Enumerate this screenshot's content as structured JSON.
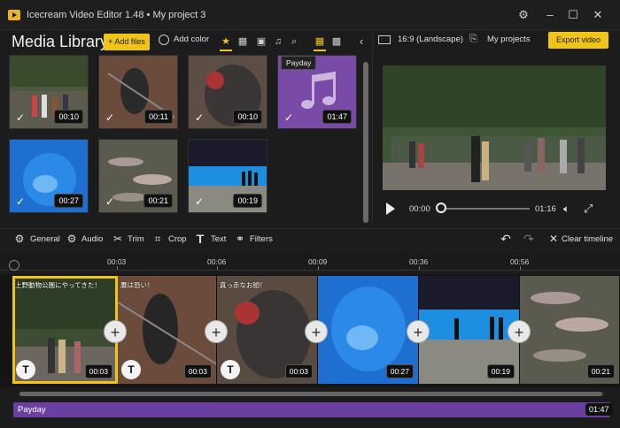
{
  "window": {
    "title": "Icecream Video Editor 1.48 • My project 3"
  },
  "library": {
    "title": "Media Library",
    "add_files": "+ Add files",
    "add_color": "Add color",
    "tooltip": "Payday",
    "items": [
      {
        "duration": "00:10",
        "kind": "video-zoo-people"
      },
      {
        "duration": "00:11",
        "kind": "video-bird-cage"
      },
      {
        "duration": "00:10",
        "kind": "video-bird-closeup"
      },
      {
        "duration": "01:47",
        "kind": "audio-payday"
      },
      {
        "duration": "00:27",
        "kind": "video-aquarium-blue"
      },
      {
        "duration": "00:21",
        "kind": "video-fish-school"
      },
      {
        "duration": "00:19",
        "kind": "video-aquarium-silhouette"
      }
    ]
  },
  "topright": {
    "aspect": "16:9 (Landscape)",
    "my_projects": "My projects",
    "export": "Export video"
  },
  "player": {
    "current": "00:00",
    "total": "01:16"
  },
  "edit_tools": {
    "general": "General",
    "audio": "Audio",
    "trim": "Trim",
    "crop": "Crop",
    "text": "Text",
    "filters": "Filters",
    "clear": "Clear timeline"
  },
  "ruler": {
    "labels": [
      "00:03",
      "00:06",
      "00:09",
      "00:36",
      "00:56"
    ]
  },
  "timeline": {
    "clips": [
      {
        "caption": "上野動物公園にやってきた！",
        "duration": "00:03",
        "has_text": true
      },
      {
        "caption": "鷹は恐い！",
        "duration": "00:03",
        "has_text": true
      },
      {
        "caption": "真っ赤なお顔！",
        "duration": "00:03",
        "has_text": true
      },
      {
        "caption": "",
        "duration": "00:27",
        "has_text": false
      },
      {
        "caption": "",
        "duration": "00:19",
        "has_text": false
      },
      {
        "caption": "",
        "duration": "00:21",
        "has_text": false
      }
    ],
    "audio_track": {
      "label": "Payday",
      "duration": "01:47"
    }
  },
  "colors": {
    "accent": "#f0c419",
    "audio": "#6a3fa0",
    "background": "#1c1c1c"
  }
}
